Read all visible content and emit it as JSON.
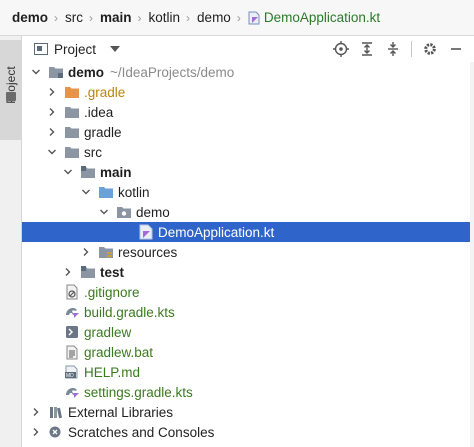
{
  "breadcrumb": [
    {
      "label": "demo",
      "bold": true
    },
    {
      "label": "src",
      "bold": false
    },
    {
      "label": "main",
      "bold": true
    },
    {
      "label": "kotlin",
      "bold": false
    },
    {
      "label": "demo",
      "bold": false
    },
    {
      "label": "DemoApplication.kt",
      "bold": false,
      "file": true
    }
  ],
  "left_strip": {
    "tab_label": "Project"
  },
  "toolbar": {
    "title": "Project"
  },
  "tree": {
    "root_label": "demo",
    "root_path": "~/IdeaProjects/demo",
    "gradle_hidden": ".gradle",
    "idea": ".idea",
    "gradle": "gradle",
    "src": "src",
    "main": "main",
    "kotlin": "kotlin",
    "demo_pkg": "demo",
    "demo_app": "DemoApplication.kt",
    "resources": "resources",
    "test": "test",
    "gitignore": ".gitignore",
    "build_gradle": "build.gradle.kts",
    "gradlew": "gradlew",
    "gradlew_bat": "gradlew.bat",
    "help": "HELP.md",
    "settings_gradle": "settings.gradle.kts",
    "external_libs": "External Libraries",
    "scratches": "Scratches and Consoles"
  },
  "colors": {
    "selection": "#2f65ca",
    "file_green": "#3a7a1f",
    "folder_grey": "#8c96a3",
    "folder_orange": "#e8934a",
    "folder_blue": "#6aa1d9"
  }
}
